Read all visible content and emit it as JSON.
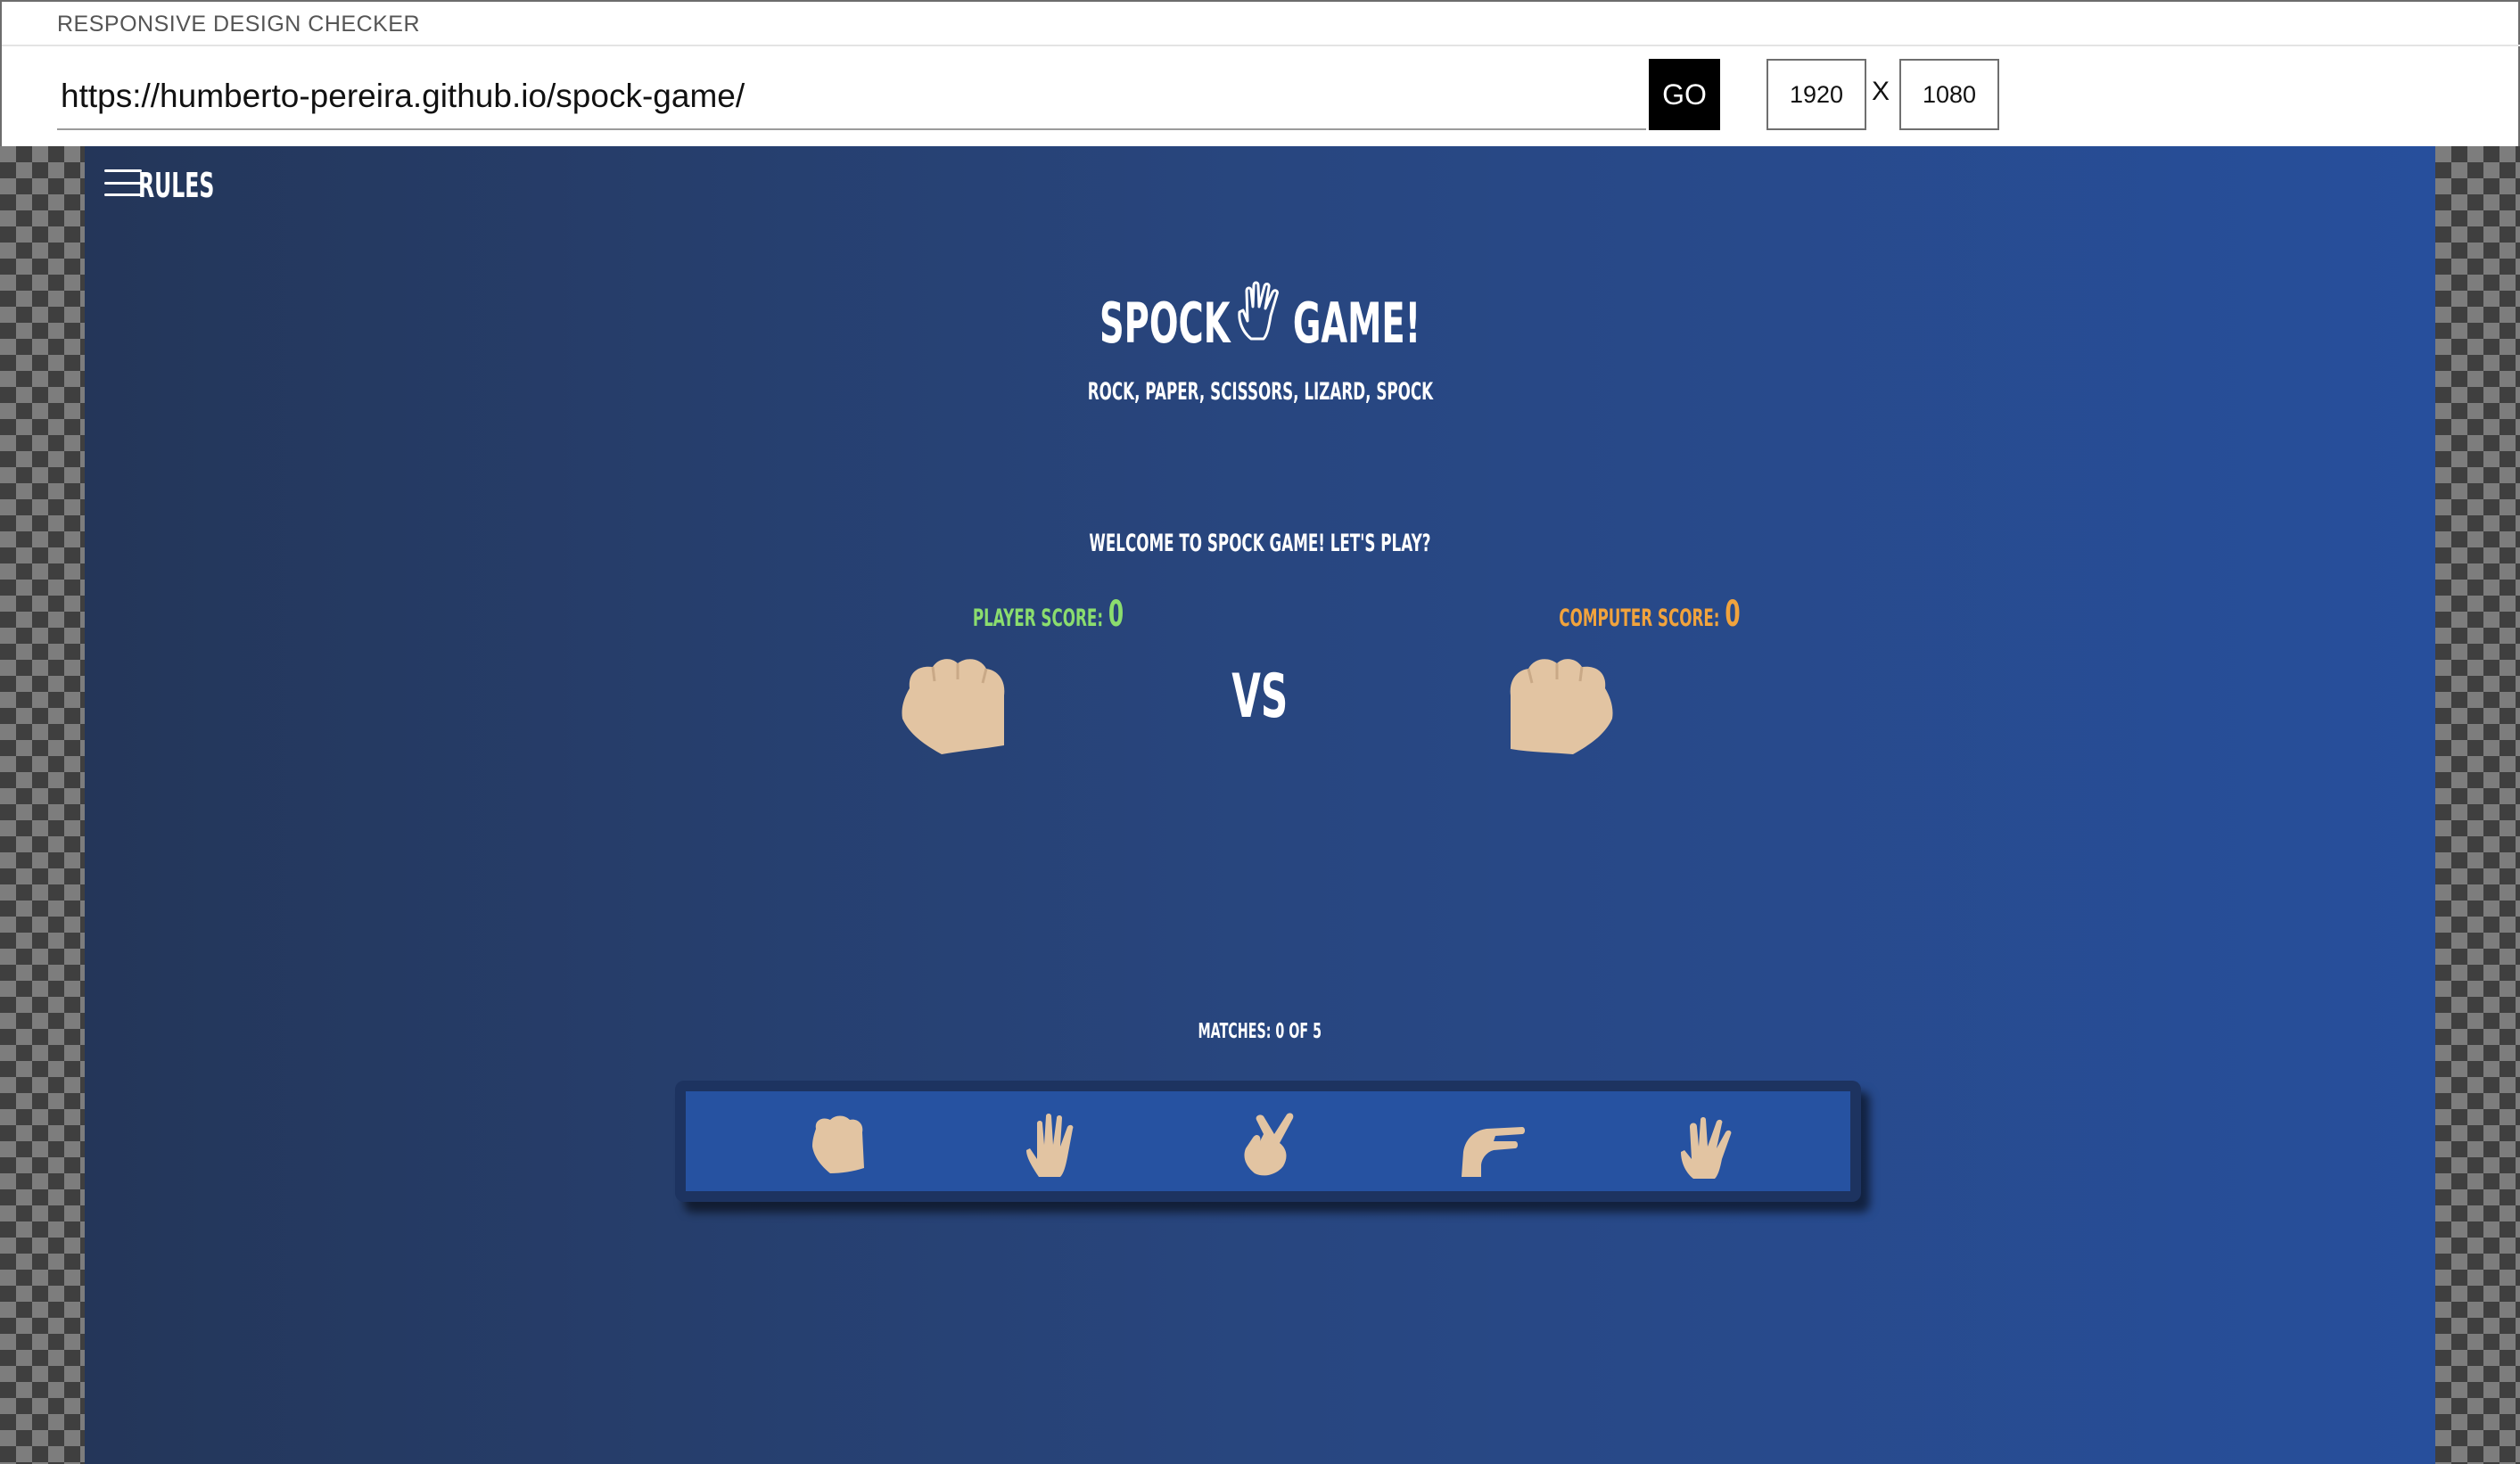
{
  "checker": {
    "title": "RESPONSIVE DESIGN CHECKER",
    "url": "https://humberto-pereira.github.io/spock-game/",
    "go_label": "GO",
    "width": "1920",
    "x_label": "X",
    "height": "1080"
  },
  "game": {
    "menu_label": "RULES",
    "title_left": "SPOCK",
    "title_right": "GAME!",
    "subtitle": "ROCK, PAPER, SCISSORS, LIZARD, SPOCK",
    "welcome": "WELCOME TO SPOCK GAME! LET'S PLAY?",
    "player_score_label": "PLAYER SCORE:",
    "player_score": "0",
    "computer_score_label": "COMPUTER SCORE:",
    "computer_score": "0",
    "vs": "VS",
    "matches": "MATCHES: 0 OF 5",
    "choices": [
      "rock-icon",
      "paper-icon",
      "scissors-icon",
      "lizard-icon",
      "spock-icon"
    ]
  },
  "colors": {
    "player": "#8bdd6e",
    "computer": "#f1a33d",
    "skin": "#e2c4a2",
    "panel": "#2652a1"
  }
}
